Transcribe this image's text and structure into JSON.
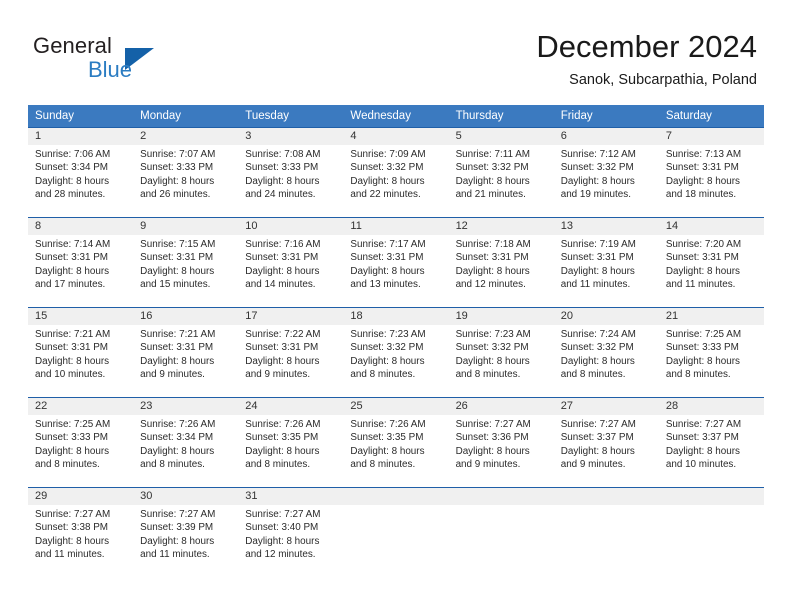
{
  "logo": {
    "word_top": "General",
    "word_bottom": "Blue",
    "triangle_color": "#1461a8",
    "blue_color": "#2b7cc2"
  },
  "header": {
    "title": "December 2024",
    "location": "Sanok, Subcarpathia, Poland"
  },
  "theme": {
    "header_blue": "#3b7ac0",
    "row_divider_blue": "#1f5fa8",
    "day_band_gray": "#f0f0f0"
  },
  "weekdays": [
    "Sunday",
    "Monday",
    "Tuesday",
    "Wednesday",
    "Thursday",
    "Friday",
    "Saturday"
  ],
  "weeks": [
    [
      {
        "day": "1",
        "sunrise": "Sunrise: 7:06 AM",
        "sunset": "Sunset: 3:34 PM",
        "daylight_line1": "Daylight: 8 hours",
        "daylight_line2": "and 28 minutes."
      },
      {
        "day": "2",
        "sunrise": "Sunrise: 7:07 AM",
        "sunset": "Sunset: 3:33 PM",
        "daylight_line1": "Daylight: 8 hours",
        "daylight_line2": "and 26 minutes."
      },
      {
        "day": "3",
        "sunrise": "Sunrise: 7:08 AM",
        "sunset": "Sunset: 3:33 PM",
        "daylight_line1": "Daylight: 8 hours",
        "daylight_line2": "and 24 minutes."
      },
      {
        "day": "4",
        "sunrise": "Sunrise: 7:09 AM",
        "sunset": "Sunset: 3:32 PM",
        "daylight_line1": "Daylight: 8 hours",
        "daylight_line2": "and 22 minutes."
      },
      {
        "day": "5",
        "sunrise": "Sunrise: 7:11 AM",
        "sunset": "Sunset: 3:32 PM",
        "daylight_line1": "Daylight: 8 hours",
        "daylight_line2": "and 21 minutes."
      },
      {
        "day": "6",
        "sunrise": "Sunrise: 7:12 AM",
        "sunset": "Sunset: 3:32 PM",
        "daylight_line1": "Daylight: 8 hours",
        "daylight_line2": "and 19 minutes."
      },
      {
        "day": "7",
        "sunrise": "Sunrise: 7:13 AM",
        "sunset": "Sunset: 3:31 PM",
        "daylight_line1": "Daylight: 8 hours",
        "daylight_line2": "and 18 minutes."
      }
    ],
    [
      {
        "day": "8",
        "sunrise": "Sunrise: 7:14 AM",
        "sunset": "Sunset: 3:31 PM",
        "daylight_line1": "Daylight: 8 hours",
        "daylight_line2": "and 17 minutes."
      },
      {
        "day": "9",
        "sunrise": "Sunrise: 7:15 AM",
        "sunset": "Sunset: 3:31 PM",
        "daylight_line1": "Daylight: 8 hours",
        "daylight_line2": "and 15 minutes."
      },
      {
        "day": "10",
        "sunrise": "Sunrise: 7:16 AM",
        "sunset": "Sunset: 3:31 PM",
        "daylight_line1": "Daylight: 8 hours",
        "daylight_line2": "and 14 minutes."
      },
      {
        "day": "11",
        "sunrise": "Sunrise: 7:17 AM",
        "sunset": "Sunset: 3:31 PM",
        "daylight_line1": "Daylight: 8 hours",
        "daylight_line2": "and 13 minutes."
      },
      {
        "day": "12",
        "sunrise": "Sunrise: 7:18 AM",
        "sunset": "Sunset: 3:31 PM",
        "daylight_line1": "Daylight: 8 hours",
        "daylight_line2": "and 12 minutes."
      },
      {
        "day": "13",
        "sunrise": "Sunrise: 7:19 AM",
        "sunset": "Sunset: 3:31 PM",
        "daylight_line1": "Daylight: 8 hours",
        "daylight_line2": "and 11 minutes."
      },
      {
        "day": "14",
        "sunrise": "Sunrise: 7:20 AM",
        "sunset": "Sunset: 3:31 PM",
        "daylight_line1": "Daylight: 8 hours",
        "daylight_line2": "and 11 minutes."
      }
    ],
    [
      {
        "day": "15",
        "sunrise": "Sunrise: 7:21 AM",
        "sunset": "Sunset: 3:31 PM",
        "daylight_line1": "Daylight: 8 hours",
        "daylight_line2": "and 10 minutes."
      },
      {
        "day": "16",
        "sunrise": "Sunrise: 7:21 AM",
        "sunset": "Sunset: 3:31 PM",
        "daylight_line1": "Daylight: 8 hours",
        "daylight_line2": "and 9 minutes."
      },
      {
        "day": "17",
        "sunrise": "Sunrise: 7:22 AM",
        "sunset": "Sunset: 3:31 PM",
        "daylight_line1": "Daylight: 8 hours",
        "daylight_line2": "and 9 minutes."
      },
      {
        "day": "18",
        "sunrise": "Sunrise: 7:23 AM",
        "sunset": "Sunset: 3:32 PM",
        "daylight_line1": "Daylight: 8 hours",
        "daylight_line2": "and 8 minutes."
      },
      {
        "day": "19",
        "sunrise": "Sunrise: 7:23 AM",
        "sunset": "Sunset: 3:32 PM",
        "daylight_line1": "Daylight: 8 hours",
        "daylight_line2": "and 8 minutes."
      },
      {
        "day": "20",
        "sunrise": "Sunrise: 7:24 AM",
        "sunset": "Sunset: 3:32 PM",
        "daylight_line1": "Daylight: 8 hours",
        "daylight_line2": "and 8 minutes."
      },
      {
        "day": "21",
        "sunrise": "Sunrise: 7:25 AM",
        "sunset": "Sunset: 3:33 PM",
        "daylight_line1": "Daylight: 8 hours",
        "daylight_line2": "and 8 minutes."
      }
    ],
    [
      {
        "day": "22",
        "sunrise": "Sunrise: 7:25 AM",
        "sunset": "Sunset: 3:33 PM",
        "daylight_line1": "Daylight: 8 hours",
        "daylight_line2": "and 8 minutes."
      },
      {
        "day": "23",
        "sunrise": "Sunrise: 7:26 AM",
        "sunset": "Sunset: 3:34 PM",
        "daylight_line1": "Daylight: 8 hours",
        "daylight_line2": "and 8 minutes."
      },
      {
        "day": "24",
        "sunrise": "Sunrise: 7:26 AM",
        "sunset": "Sunset: 3:35 PM",
        "daylight_line1": "Daylight: 8 hours",
        "daylight_line2": "and 8 minutes."
      },
      {
        "day": "25",
        "sunrise": "Sunrise: 7:26 AM",
        "sunset": "Sunset: 3:35 PM",
        "daylight_line1": "Daylight: 8 hours",
        "daylight_line2": "and 8 minutes."
      },
      {
        "day": "26",
        "sunrise": "Sunrise: 7:27 AM",
        "sunset": "Sunset: 3:36 PM",
        "daylight_line1": "Daylight: 8 hours",
        "daylight_line2": "and 9 minutes."
      },
      {
        "day": "27",
        "sunrise": "Sunrise: 7:27 AM",
        "sunset": "Sunset: 3:37 PM",
        "daylight_line1": "Daylight: 8 hours",
        "daylight_line2": "and 9 minutes."
      },
      {
        "day": "28",
        "sunrise": "Sunrise: 7:27 AM",
        "sunset": "Sunset: 3:37 PM",
        "daylight_line1": "Daylight: 8 hours",
        "daylight_line2": "and 10 minutes."
      }
    ],
    [
      {
        "day": "29",
        "sunrise": "Sunrise: 7:27 AM",
        "sunset": "Sunset: 3:38 PM",
        "daylight_line1": "Daylight: 8 hours",
        "daylight_line2": "and 11 minutes."
      },
      {
        "day": "30",
        "sunrise": "Sunrise: 7:27 AM",
        "sunset": "Sunset: 3:39 PM",
        "daylight_line1": "Daylight: 8 hours",
        "daylight_line2": "and 11 minutes."
      },
      {
        "day": "31",
        "sunrise": "Sunrise: 7:27 AM",
        "sunset": "Sunset: 3:40 PM",
        "daylight_line1": "Daylight: 8 hours",
        "daylight_line2": "and 12 minutes."
      },
      {
        "day": "",
        "sunrise": "",
        "sunset": "",
        "daylight_line1": "",
        "daylight_line2": ""
      },
      {
        "day": "",
        "sunrise": "",
        "sunset": "",
        "daylight_line1": "",
        "daylight_line2": ""
      },
      {
        "day": "",
        "sunrise": "",
        "sunset": "",
        "daylight_line1": "",
        "daylight_line2": ""
      },
      {
        "day": "",
        "sunrise": "",
        "sunset": "",
        "daylight_line1": "",
        "daylight_line2": ""
      }
    ]
  ]
}
